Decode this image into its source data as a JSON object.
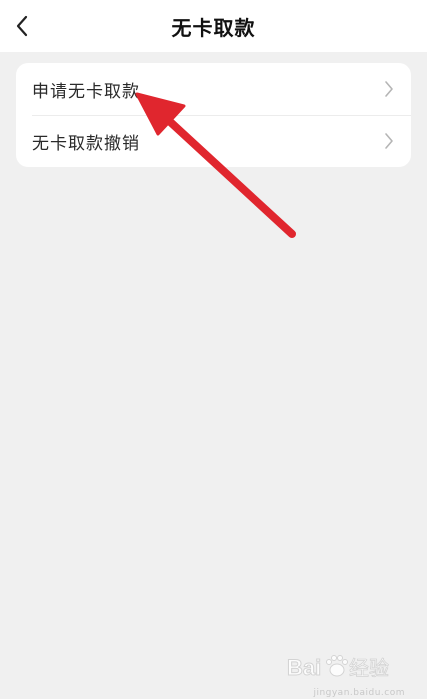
{
  "header": {
    "title": "无卡取款",
    "back_icon": "chevron-left-icon"
  },
  "menu": {
    "items": [
      {
        "label": "申请无卡取款",
        "icon": "chevron-right-icon"
      },
      {
        "label": "无卡取款撤销",
        "icon": "chevron-right-icon"
      }
    ]
  },
  "annotation": {
    "color": "#e0262e"
  },
  "watermark": {
    "brand": "Baidu 经验",
    "url": "jingyan.baidu.com"
  }
}
